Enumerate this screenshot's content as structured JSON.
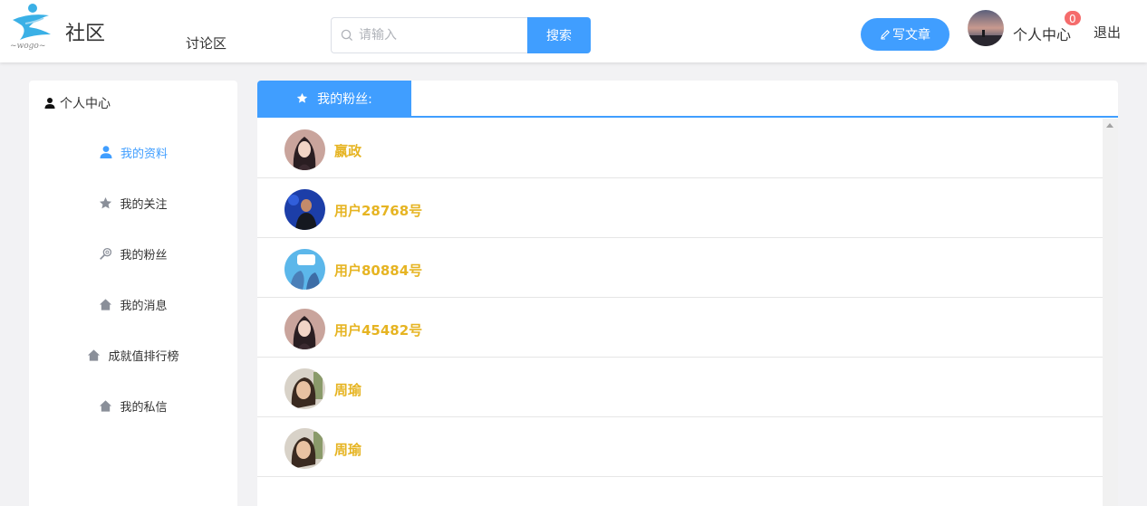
{
  "header": {
    "site_name": "社区",
    "logo_text": "~wogo~",
    "nav_forum": "讨论区",
    "search_placeholder": "请输入",
    "search_button": "搜索",
    "write_button": "写文章",
    "user_center": "个人中心",
    "notification_count": "0",
    "logout": "退出"
  },
  "sidebar": {
    "title": "个人中心",
    "items": [
      {
        "label": "我的资料",
        "icon": "user-icon",
        "active": true
      },
      {
        "label": "我的关注",
        "icon": "star-icon",
        "active": false
      },
      {
        "label": "我的粉丝",
        "icon": "magnify-icon",
        "active": false
      },
      {
        "label": "我的消息",
        "icon": "home-icon",
        "active": false
      },
      {
        "label": "成就值排行榜",
        "icon": "home-icon",
        "active": false
      },
      {
        "label": "我的私信",
        "icon": "home-icon",
        "active": false
      }
    ]
  },
  "main": {
    "tab_label": "我的粉丝:",
    "fans": [
      {
        "name": "嬴政"
      },
      {
        "name": "用户28768号"
      },
      {
        "name": "用户80884号"
      },
      {
        "name": "用户45482号"
      },
      {
        "name": "周瑜"
      },
      {
        "name": "周瑜"
      }
    ]
  },
  "colors": {
    "accent": "#409eff",
    "username": "#e6b422",
    "badge": "#f56c6c",
    "page_bg": "#f2f2f4"
  }
}
